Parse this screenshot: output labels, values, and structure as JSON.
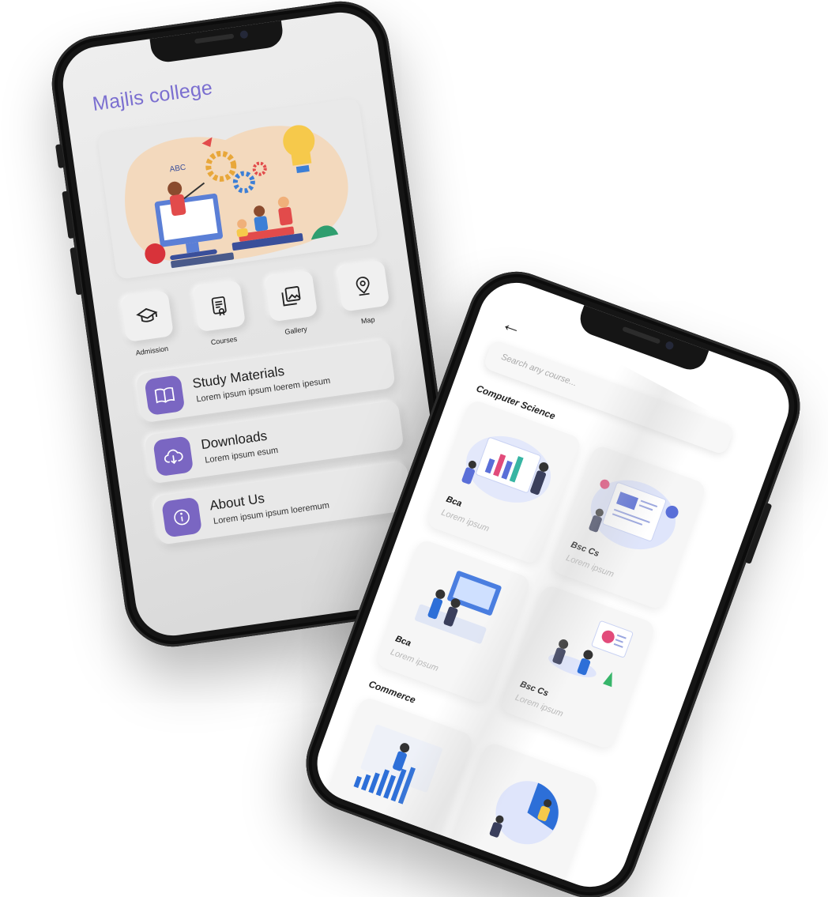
{
  "home": {
    "title": "Majlis college",
    "quick_links": [
      {
        "label": "Admission",
        "icon": "graduation-cap-icon"
      },
      {
        "label": "Courses",
        "icon": "certificate-icon"
      },
      {
        "label": "Gallery",
        "icon": "gallery-icon"
      },
      {
        "label": "Map",
        "icon": "map-pin-icon"
      }
    ],
    "menu": [
      {
        "title": "Study Materials",
        "subtitle": "Lorem ipsum ipsum loerem ipesum",
        "icon": "book-icon"
      },
      {
        "title": "Downloads",
        "subtitle": "Lorem ipsum esum",
        "icon": "cloud-download-icon"
      },
      {
        "title": "About  Us",
        "subtitle": "Lorem ipsum ipsum loeremum",
        "icon": "info-icon"
      }
    ],
    "accent_color": "#7a66c2",
    "title_color": "#7b6fd0"
  },
  "courses": {
    "search_placeholder": "Search any course...",
    "sections": [
      {
        "title": "Computer Science",
        "items": [
          {
            "name": "Bca",
            "subtitle": "Lorem ipsum"
          },
          {
            "name": "Bsc Cs",
            "subtitle": "Lorem ipsum"
          },
          {
            "name": "Bca",
            "subtitle": "Lorem ipsum"
          },
          {
            "name": "Bsc Cs",
            "subtitle": "Lorem ipsum"
          }
        ]
      },
      {
        "title": "Commerce",
        "items": [
          {
            "name": "",
            "subtitle": ""
          },
          {
            "name": "",
            "subtitle": ""
          }
        ]
      }
    ]
  }
}
